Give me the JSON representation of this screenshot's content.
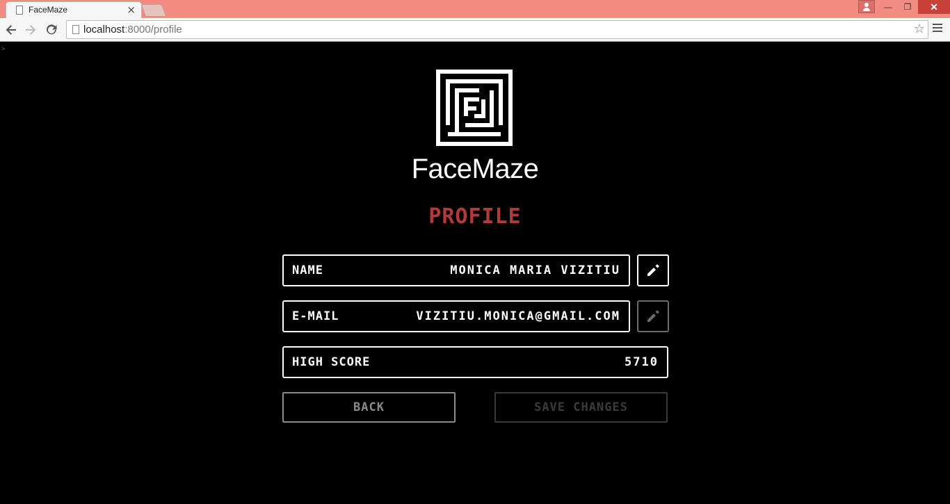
{
  "browser": {
    "tab_title": "FaceMaze",
    "tab_close": "×",
    "url_host": "localhost",
    "url_path": ":8000/profile",
    "star": "☆",
    "win_min": "—",
    "win_max": "❐",
    "win_close": "✕"
  },
  "page": {
    "corner_mark": ">",
    "brand": "FaceMaze",
    "heading": "PROFILE",
    "fields": {
      "name": {
        "label": "NAME",
        "value": "MONICA MARIA VIZITIU"
      },
      "email": {
        "label": "E-MAIL",
        "value": "VIZITIU.MONICA@GMAIL.COM"
      },
      "high_score": {
        "label": "HIGH SCORE",
        "value": "5710"
      }
    },
    "buttons": {
      "back": "BACK",
      "save": "SAVE CHANGES"
    }
  },
  "colors": {
    "titlebar": "#f28b82",
    "heading": "#b13a3a",
    "background": "#000000"
  }
}
